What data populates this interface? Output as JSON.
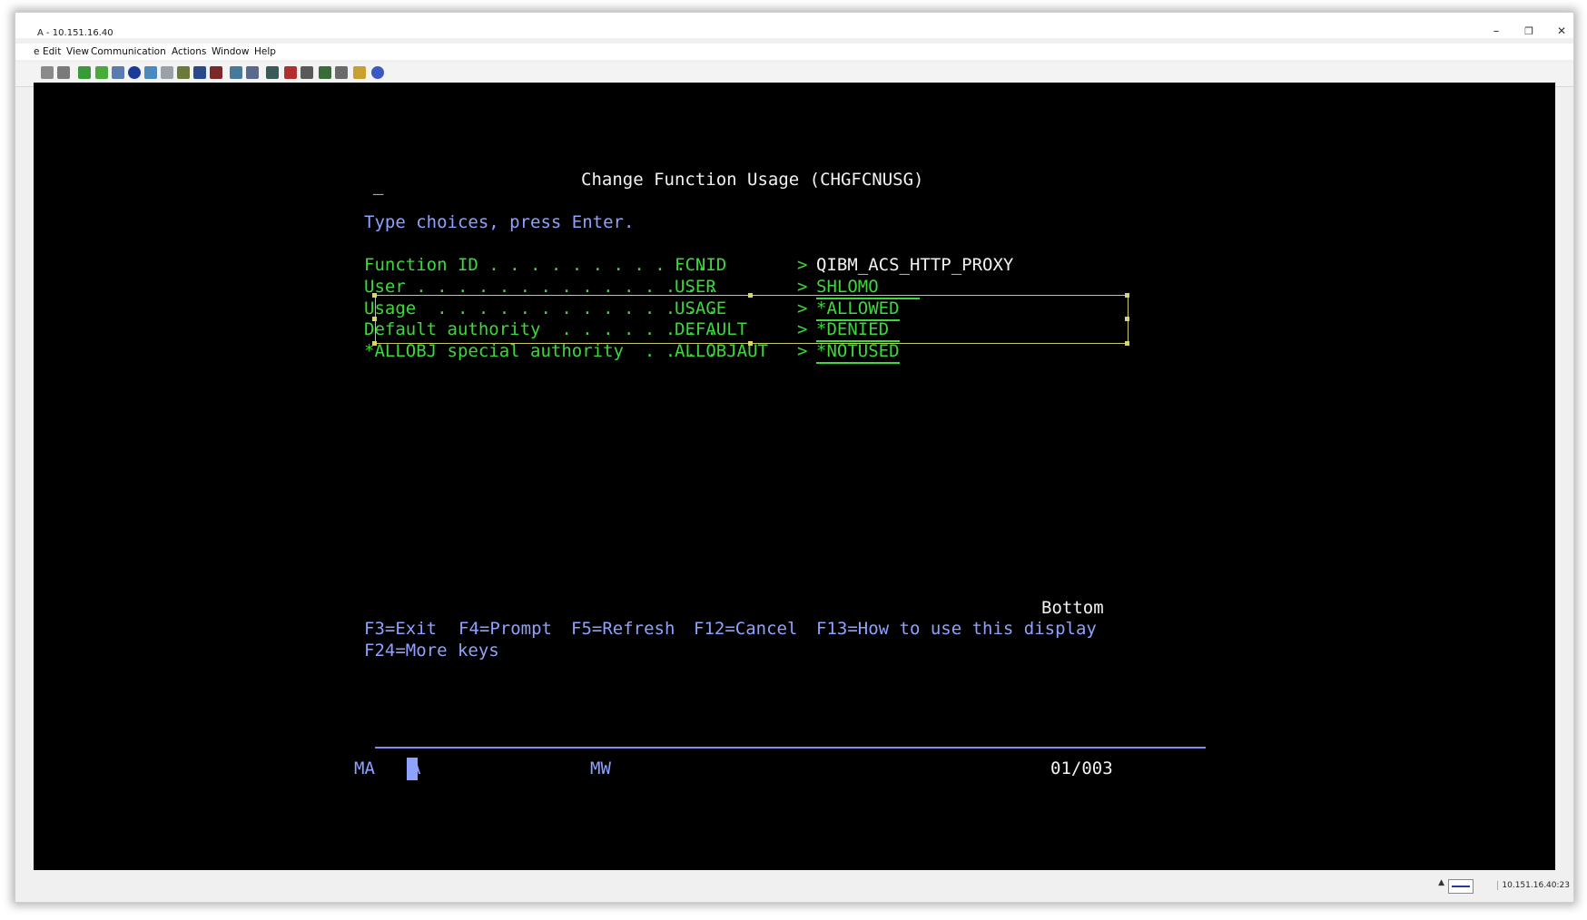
{
  "window": {
    "title": "A - 10.151.16.40",
    "minimize": "–",
    "restore": "❐",
    "close": "✕"
  },
  "menubar": [
    "e",
    "Edit",
    "View",
    "Communication",
    "Actions",
    "Window",
    "Help"
  ],
  "toolbar": {
    "icons": [
      "copy-icon",
      "paste-icon",
      "send-file-icon",
      "receive-file-icon",
      "print-screen-icon",
      "record-icon",
      "display-icon",
      "notes-icon",
      "macro-icon",
      "keyboard-icon",
      "map-icon",
      "customize-icon",
      "keypad-icon",
      "transfer-icon",
      "stop-icon",
      "properties-icon",
      "download-icon",
      "config-icon",
      "clipboard-icon",
      "help-icon"
    ]
  },
  "screen": {
    "cursor_mark": "_",
    "title": "Change Function Usage (CHGFCNUSG)",
    "instruction": "Type choices, press Enter.",
    "fields": [
      {
        "label": "Function ID . . . . . . . . . . .",
        "keyword": "FCNID",
        "arrow": ">",
        "value": "QIBM_ACS_HTTP_PROXY",
        "underlined": false
      },
      {
        "label": "User . . . . . . . . . . . . . . .",
        "keyword": "USER",
        "arrow": ">",
        "value": "SHLOMO    ",
        "underlined": true
      },
      {
        "label": "Usage  . . . . . . . . . . . . . .",
        "keyword": "USAGE",
        "arrow": ">",
        "value": "*ALLOWED",
        "underlined": true
      },
      {
        "label": "Default authority  . . . . . . . .",
        "keyword": "DEFAULT",
        "arrow": ">",
        "value": "*DENIED ",
        "underlined": true
      },
      {
        "label": "*ALLOBJ special authority  . . . .",
        "keyword": "ALLOBJAUT",
        "arrow": ">",
        "value": "*NOTUSED",
        "underlined": true
      }
    ],
    "bottom": "Bottom",
    "fkeys_line1": [
      "F3=Exit",
      "F4=Prompt",
      "F5=Refresh",
      "F12=Cancel",
      "F13=How to use this display"
    ],
    "fkeys_line2": [
      "F24=More keys"
    ],
    "status": {
      "session": "MA",
      "mode": "A",
      "workstation": "MW",
      "position": "01/003"
    }
  },
  "statusbar": {
    "up_arrow": "▲",
    "address": "10.151.16.40:23"
  }
}
